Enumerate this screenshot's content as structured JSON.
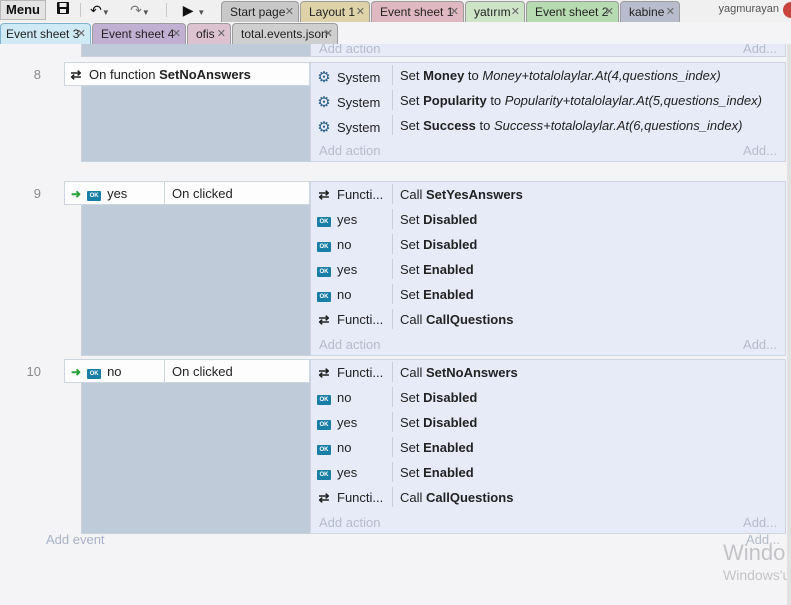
{
  "toolbar": {
    "menu_label": "Menu",
    "save_icon": "save-icon",
    "undo_icon": "undo-icon",
    "redo_icon": "redo-icon",
    "run_icon": "play-icon"
  },
  "tabs_row1": [
    {
      "label": "Start page",
      "color": "#c8c8c8"
    },
    {
      "label": "Layout 1",
      "color": "#ddd2a8"
    },
    {
      "label": "Event sheet 1",
      "color": "#e0b8c2"
    },
    {
      "label": "yatırım",
      "color": "#cde4c6"
    },
    {
      "label": "Event sheet 2",
      "color": "#b7dbb0"
    },
    {
      "label": "kabine",
      "color": "#b9bccc"
    }
  ],
  "tabs_row2": [
    {
      "label": "Event sheet 3",
      "color": "#cfe9f5",
      "active": true
    },
    {
      "label": "Event sheet 4",
      "color": "#c2b0d2"
    },
    {
      "label": "ofis",
      "color": "#ddc3cf"
    },
    {
      "label": "total.events.json",
      "color": "#cfcfcf"
    }
  ],
  "user": {
    "name": "yagmurayan"
  },
  "sheet": {
    "add_action_label": "Add action",
    "add_action_short": "Add...",
    "add_event_label": "Add event",
    "add_event_short": "Add...",
    "events": [
      {
        "number": "8",
        "condition": {
          "icon": "function-icon",
          "prefix": "On function ",
          "name": "SetNoAnswers"
        },
        "actions": [
          {
            "object": "System",
            "icon": "gear-icon",
            "verb": "Set ",
            "target": "Money",
            "mid": " to ",
            "value": "Money+totalolaylar.At(4,questions_index)"
          },
          {
            "object": "System",
            "icon": "gear-icon",
            "verb": "Set ",
            "target": "Popularity",
            "mid": " to ",
            "value": "Popularity+totalolaylar.At(5,questions_index)"
          },
          {
            "object": "System",
            "icon": "gear-icon",
            "verb": "Set ",
            "target": "Success",
            "mid": " to ",
            "value": "Success+totalolaylar.At(6,questions_index)"
          }
        ]
      },
      {
        "number": "9",
        "condition": {
          "icon": "button-icon",
          "object": "yes",
          "trigger": "On clicked"
        },
        "actions": [
          {
            "object": "Functi...",
            "icon": "function-icon",
            "verb": "Call ",
            "target": "SetYesAnswers"
          },
          {
            "object": "yes",
            "icon": "button-icon",
            "verb": "Set ",
            "target": "Disabled"
          },
          {
            "object": "no",
            "icon": "button-icon",
            "verb": "Set ",
            "target": "Disabled"
          },
          {
            "object": "yes",
            "icon": "button-icon",
            "verb": "Set ",
            "target": "Enabled"
          },
          {
            "object": "no",
            "icon": "button-icon",
            "verb": "Set ",
            "target": "Enabled"
          },
          {
            "object": "Functi...",
            "icon": "function-icon",
            "verb": "Call ",
            "target": "CallQuestions"
          }
        ]
      },
      {
        "number": "10",
        "condition": {
          "icon": "button-icon",
          "object": "no",
          "trigger": "On clicked"
        },
        "actions": [
          {
            "object": "Functi...",
            "icon": "function-icon",
            "verb": "Call ",
            "target": "SetNoAnswers"
          },
          {
            "object": "no",
            "icon": "button-icon",
            "verb": "Set ",
            "target": "Disabled"
          },
          {
            "object": "yes",
            "icon": "button-icon",
            "verb": "Set ",
            "target": "Disabled"
          },
          {
            "object": "no",
            "icon": "button-icon",
            "verb": "Set ",
            "target": "Enabled"
          },
          {
            "object": "yes",
            "icon": "button-icon",
            "verb": "Set ",
            "target": "Enabled"
          },
          {
            "object": "Functi...",
            "icon": "function-icon",
            "verb": "Call ",
            "target": "CallQuestions"
          }
        ]
      }
    ]
  },
  "watermark": {
    "line1": "Windo",
    "line2": "Windows'u"
  },
  "colors": {
    "event_block": "#c0cbd9",
    "action_bg": "#e7ebf7",
    "button_icon": "#1a7fa6",
    "gear_icon": "#2a5f86",
    "trigger_arrow": "#2ca338"
  }
}
